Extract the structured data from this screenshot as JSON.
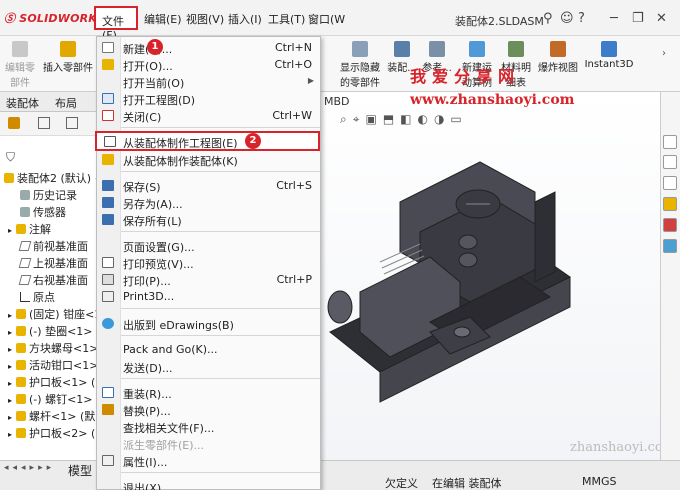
{
  "app": {
    "logo": "SOLIDWORKS",
    "doc_title": "装配体2.SLDASM"
  },
  "menubar": [
    "文件(F)",
    "编辑(E)",
    "视图(V)",
    "插入(I)",
    "工具(T)",
    "窗口(W"
  ],
  "ribbon": [
    {
      "label": "编辑零部件",
      "disabled": true
    },
    {
      "label": "插入零部件",
      "disabled": false
    },
    {
      "label": "显示隐藏的零部件",
      "disabled": false
    },
    {
      "label": "装配...",
      "disabled": false
    },
    {
      "label": "参考...",
      "disabled": false
    },
    {
      "label": "新建运动算例",
      "disabled": false
    },
    {
      "label": "材料明细表",
      "disabled": false
    },
    {
      "label": "爆炸视图",
      "disabled": false
    },
    {
      "label": "Instant3D",
      "disabled": false
    }
  ],
  "left_tabs": [
    "装配体",
    "布局"
  ],
  "viewport_tab": "MBD",
  "tree": [
    "装配体2 (默认) <",
    "历史记录",
    "传感器",
    "注解",
    "前视基准面",
    "上视基准面",
    "右视基准面",
    "原点",
    "(固定) 钳座<1",
    "(-) 垫圈<1> (",
    "方块螺母<1>",
    "活动钳口<1>",
    "护口板<1> (",
    "(-) 螺钉<1> (",
    "螺杆<1> (默",
    "护口板<2> ("
  ],
  "file_menu": [
    {
      "label": "新建(N)...",
      "shortcut": "Ctrl+N",
      "icon": "new-doc-icon"
    },
    {
      "label": "打开(O)...",
      "shortcut": "Ctrl+O",
      "icon": "open-folder-icon"
    },
    {
      "label": "打开当前(O)",
      "shortcut": "",
      "icon": "",
      "submenu": true
    },
    {
      "label": "打开工程图(D)",
      "shortcut": "",
      "icon": "drawing-icon"
    },
    {
      "label": "关闭(C)",
      "shortcut": "Ctrl+W",
      "icon": "close-doc-icon"
    },
    {
      "label": "从装配体制作工程图(E)",
      "shortcut": "",
      "icon": "make-drawing-icon",
      "highlight": true
    },
    {
      "label": "从装配体制作装配体(K)",
      "shortcut": "",
      "icon": "make-assembly-icon"
    },
    {
      "label": "保存(S)",
      "shortcut": "Ctrl+S",
      "icon": "save-icon"
    },
    {
      "label": "另存为(A)...",
      "shortcut": "",
      "icon": "save-as-icon"
    },
    {
      "label": "保存所有(L)",
      "shortcut": "",
      "icon": "save-all-icon"
    },
    {
      "label": "页面设置(G)...",
      "shortcut": "",
      "icon": ""
    },
    {
      "label": "打印预览(V)...",
      "shortcut": "",
      "icon": "print-preview-icon"
    },
    {
      "label": "打印(P)...",
      "shortcut": "Ctrl+P",
      "icon": "print-icon"
    },
    {
      "label": "Print3D...",
      "shortcut": "",
      "icon": "print3d-icon"
    },
    {
      "label": "出版到 eDrawings(B)",
      "shortcut": "",
      "icon": "edrawings-icon"
    },
    {
      "label": "Pack and Go(K)...",
      "shortcut": "",
      "icon": ""
    },
    {
      "label": "发送(D)...",
      "shortcut": "",
      "icon": ""
    },
    {
      "label": "重装(R)...",
      "shortcut": "",
      "icon": "reload-icon"
    },
    {
      "label": "替换(P)...",
      "shortcut": "",
      "icon": "replace-icon"
    },
    {
      "label": "查找相关文件(F)...",
      "shortcut": "",
      "icon": ""
    },
    {
      "label": "派生零部件(E)...",
      "shortcut": "",
      "icon": "",
      "disabled": true
    },
    {
      "label": "属性(I)...",
      "shortcut": "",
      "icon": "properties-icon"
    },
    {
      "label": "退出(X)",
      "shortcut": "",
      "icon": ""
    }
  ],
  "annotations": {
    "badge1": "1",
    "badge2": "2"
  },
  "watermark": {
    "title": "我爱分享网",
    "url": "www.zhanshaoyi.com",
    "url_small": "zhanshaoyi.com"
  },
  "status": {
    "model_tab": "模型",
    "undefined": "欠定义",
    "editing": "在编辑 装配体",
    "units": "MMGS"
  },
  "colors": {
    "accent": "#d8232a"
  }
}
